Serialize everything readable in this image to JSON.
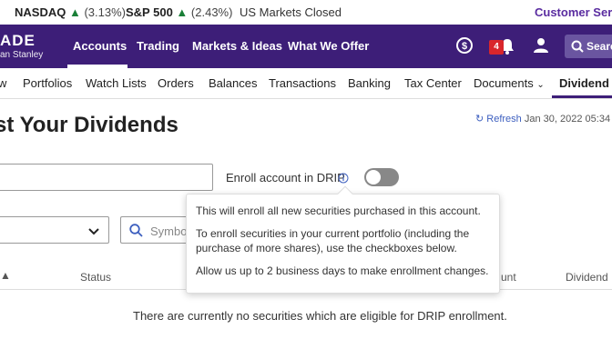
{
  "ticker": {
    "nasdaq_symbol": "NASDAQ",
    "nasdaq_change": "(3.13%)",
    "sp500_symbol": "S&P 500",
    "sp500_change": "(2.43%)",
    "market_status": "US Markets Closed",
    "customer_service": "Customer Servi"
  },
  "brand": {
    "logo_text": "ADE",
    "logo_sub": "an Stanley"
  },
  "topnav": {
    "items": [
      "Accounts",
      "Trading",
      "Markets & Ideas",
      "What We Offer"
    ],
    "notification_count": "4",
    "search_label": "Searc"
  },
  "subnav": {
    "items": [
      "w",
      "Portfolios",
      "Watch Lists",
      "Orders",
      "Balances",
      "Transactions",
      "Banking",
      "Tax Center",
      "Documents",
      "Dividend R"
    ]
  },
  "page": {
    "title": "st Your Dividends",
    "refresh_label": "Refresh",
    "refresh_time": "Jan 30, 2022 05:34"
  },
  "drip": {
    "label": "Enroll account in DRIP",
    "symbol_placeholder": "Symbo"
  },
  "tooltip": {
    "line1": "This will enroll all new securities purchased in this account.",
    "line2": "To enroll securities in your current portfolio (including the purchase of more shares), use the checkboxes below.",
    "line3": "Allow us up to 2 business days to make enrollment changes."
  },
  "table": {
    "headers": [
      "Status",
      "unt",
      "Dividend"
    ],
    "empty_message": "There are currently no securities which are eligible for DRIP enrollment."
  },
  "colors": {
    "brand_purple": "#3d1e78",
    "up_green": "#1a7f37",
    "link_blue": "#3d5fbf",
    "badge_red": "#d9262b"
  }
}
